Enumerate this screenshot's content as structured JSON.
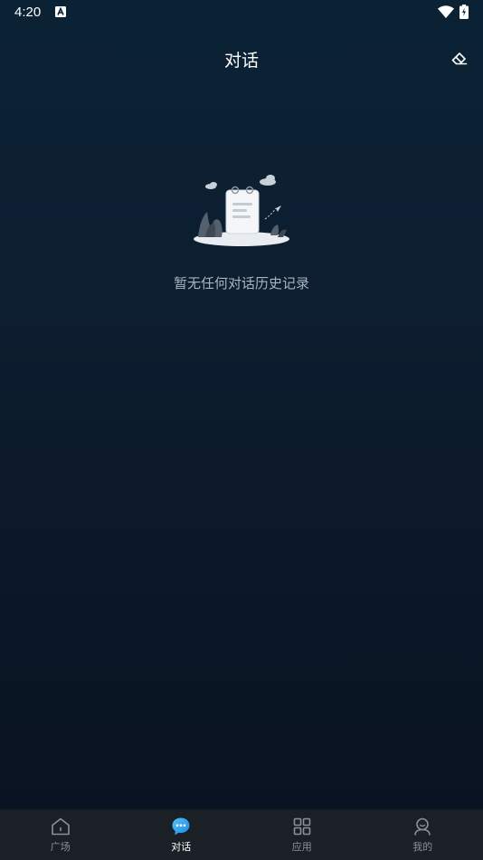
{
  "status_bar": {
    "time": "4:20"
  },
  "header": {
    "title": "对话"
  },
  "empty_state": {
    "message": "暂无任何对话历史记录"
  },
  "tab_bar": {
    "tabs": [
      {
        "label": "广场",
        "icon": "home-icon",
        "active": false
      },
      {
        "label": "对话",
        "icon": "chat-bubble-icon",
        "active": true
      },
      {
        "label": "应用",
        "icon": "grid-icon",
        "active": false
      },
      {
        "label": "我的",
        "icon": "profile-icon",
        "active": false
      }
    ]
  },
  "colors": {
    "accent": "#1e88e5",
    "tab_bar_bg": "#1b1f26",
    "inactive_tab": "#8a9199"
  }
}
